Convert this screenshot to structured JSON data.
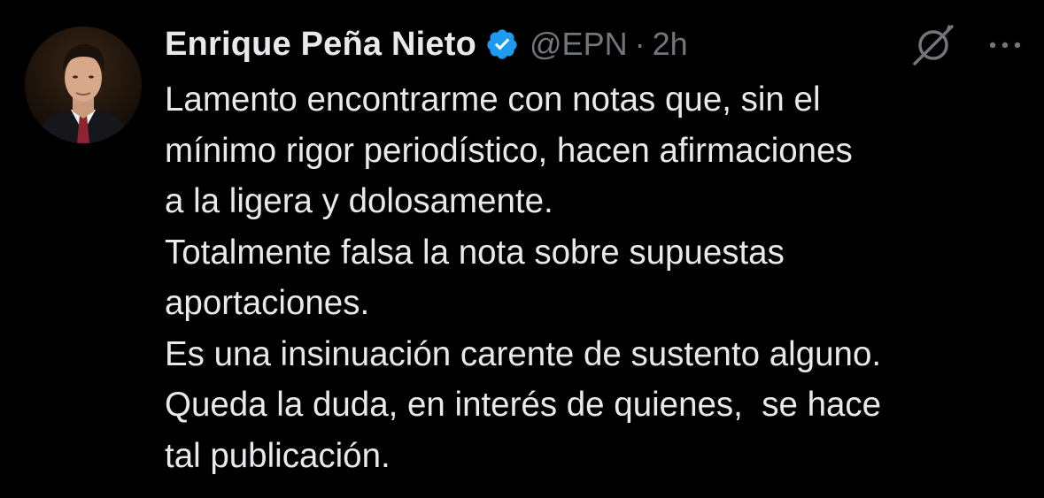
{
  "tweet": {
    "author": {
      "display_name": "Enrique Peña Nieto",
      "handle": "@EPN",
      "verified": true,
      "avatar_icon": "profile-photo"
    },
    "separator": "·",
    "timestamp": "2h",
    "actions": {
      "grok_icon": "grok-slash-icon",
      "more_icon": "more-dots-icon"
    },
    "text_lines": [
      "Lamento encontrarme con notas que, sin el",
      "mínimo rigor periodístico, hacen afirmaciones",
      "a la ligera y dolosamente.",
      "Totalmente falsa la nota sobre supuestas",
      "aportaciones.",
      "Es una insinuación carente de sustento alguno.",
      "Queda la duda, en interés de quienes,  se hace",
      "tal publicación."
    ]
  },
  "colors": {
    "background": "#000000",
    "primary_text": "#e7e9ea",
    "secondary_text": "#71767b",
    "verified_blue": "#1d9bf0"
  }
}
